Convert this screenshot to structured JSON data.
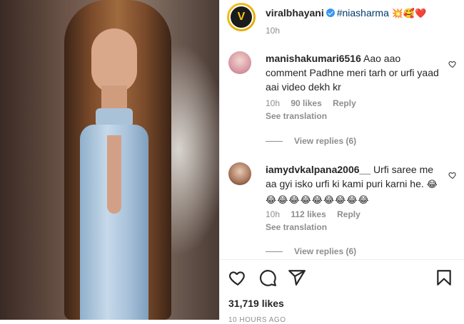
{
  "post": {
    "username": "viralbhayani",
    "hashtag": "#niasharma",
    "caption_emojis": "💥🥰❤️",
    "time": "10h",
    "avatar_letter": "V"
  },
  "comments": [
    {
      "username": "manishakumari6516",
      "text": "Aao aao comment Padhne meri tarh or urfi yaad aai video dekh kr",
      "time": "10h",
      "likes": "90 likes",
      "reply_label": "Reply",
      "see_translation": "See translation",
      "view_replies": "View replies (6)"
    },
    {
      "username": "iamydvkalpana2006__",
      "text": "Urfi saree me aa gyi isko urfi ki kami puri karni he.",
      "emojis": "😂😂😂😂😂😂😂😂😂😂",
      "time": "10h",
      "likes": "112 likes",
      "reply_label": "Reply",
      "see_translation": "See translation",
      "view_replies": "View replies (6)"
    }
  ],
  "footer": {
    "likes": "31,719 likes",
    "time_ago": "10 HOURS AGO"
  },
  "icons": {
    "like": "heart-icon",
    "comment": "comment-icon",
    "share": "share-icon",
    "save": "bookmark-icon",
    "verified": "verified-badge-icon"
  }
}
